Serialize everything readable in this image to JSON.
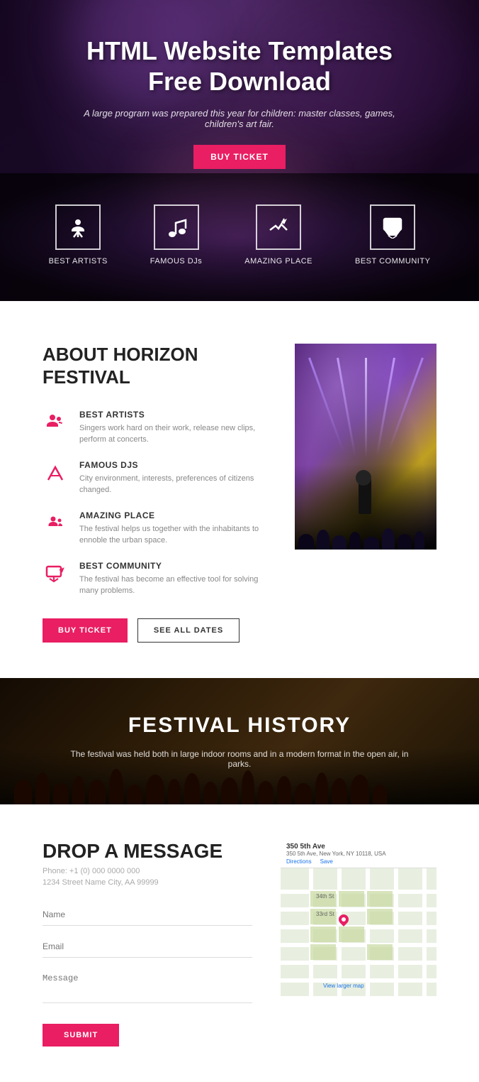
{
  "hero": {
    "title": "HTML Website Templates\nFree Download",
    "subtitle": "A large program was prepared this year for children: master classes, games, children's art fair.",
    "buy_button": "BUY TICKET",
    "icons": [
      {
        "id": "best-artists",
        "symbol": "✦",
        "label": "BEST ARTISTS"
      },
      {
        "id": "famous-djs",
        "symbol": "♪",
        "label": "FAMOUS DJs"
      },
      {
        "id": "amazing-place",
        "symbol": "✈",
        "label": "AMAZING PLACE"
      },
      {
        "id": "best-community",
        "symbol": "💬",
        "label": "BEST COMMUNITY"
      }
    ]
  },
  "about": {
    "title": "ABOUT HORIZON\nFESTIVAL",
    "items": [
      {
        "id": "best-artists",
        "heading": "BEST ARTISTS",
        "text": "Singers work hard on their work, release new clips, perform at concerts."
      },
      {
        "id": "famous-djs",
        "heading": "FAMOUS DJs",
        "text": "City environment, interests, preferences of citizens changed."
      },
      {
        "id": "amazing-place",
        "heading": "AMAZING PLACE",
        "text": "The festival helps us together with the inhabitants to ennoble the urban space."
      },
      {
        "id": "best-community",
        "heading": "BEST COMMUNITY",
        "text": "The festival has become an effective tool for solving many problems."
      }
    ],
    "buy_button": "BUY TICKET",
    "dates_button": "SEE ALL DATES"
  },
  "history": {
    "title": "FESTIVAL HISTORY",
    "subtitle": "The festival was held both in large indoor rooms and in a modern format in the open air, in parks."
  },
  "contact": {
    "title": "DROP A MESSAGE",
    "phone": "Phone: +1 (0) 000 0000 000",
    "address": "1234 Street Name City, AA 99999",
    "form": {
      "name_placeholder": "Name",
      "email_placeholder": "Email",
      "message_placeholder": "Message"
    },
    "submit_button": "SUBMIT",
    "map": {
      "header_title": "350 5th Ave",
      "header_address": "350 5th Ave, New York, NY 10118, USA",
      "action_directions": "Directions",
      "action_save": "Save",
      "action_larger": "View larger map"
    }
  }
}
